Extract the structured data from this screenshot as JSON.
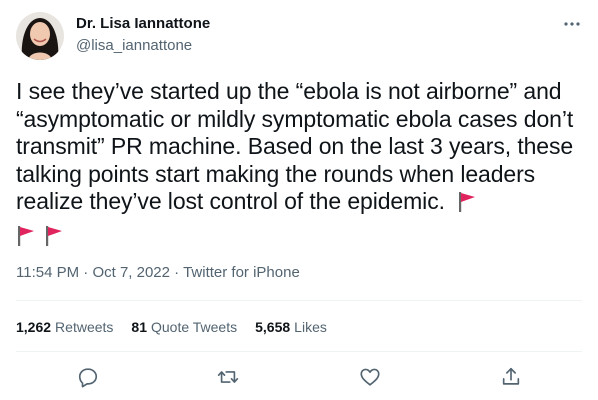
{
  "author": {
    "name": "Dr. Lisa Iannattone",
    "handle": "@lisa_iannattone",
    "avatar_icon": "avatar-photo"
  },
  "tweet": {
    "text": "I see they’ve started up the “ebola is not airborne” and “asymptomatic or mildly symptomatic ebola cases don’t transmit” PR machine. Based on the last 3 years, these talking points start making the rounds when leaders realize they’ve lost control of the epidemic.",
    "emoji": [
      "red-flag",
      "red-flag",
      "red-flag"
    ]
  },
  "meta": {
    "time": "11:54 PM",
    "date": "Oct 7, 2022",
    "source": "Twitter for iPhone",
    "separator": "·"
  },
  "stats": {
    "retweets_count": "1,262",
    "retweets_label": "Retweets",
    "quotes_count": "81",
    "quotes_label": "Quote Tweets",
    "likes_count": "5,658",
    "likes_label": "Likes"
  },
  "actions": [
    "reply-icon",
    "retweet-icon",
    "like-icon",
    "share-icon"
  ],
  "colors": {
    "text": "#0f1419",
    "secondary": "#536471",
    "divider": "#eff3f4",
    "flag": "#e0245e"
  }
}
